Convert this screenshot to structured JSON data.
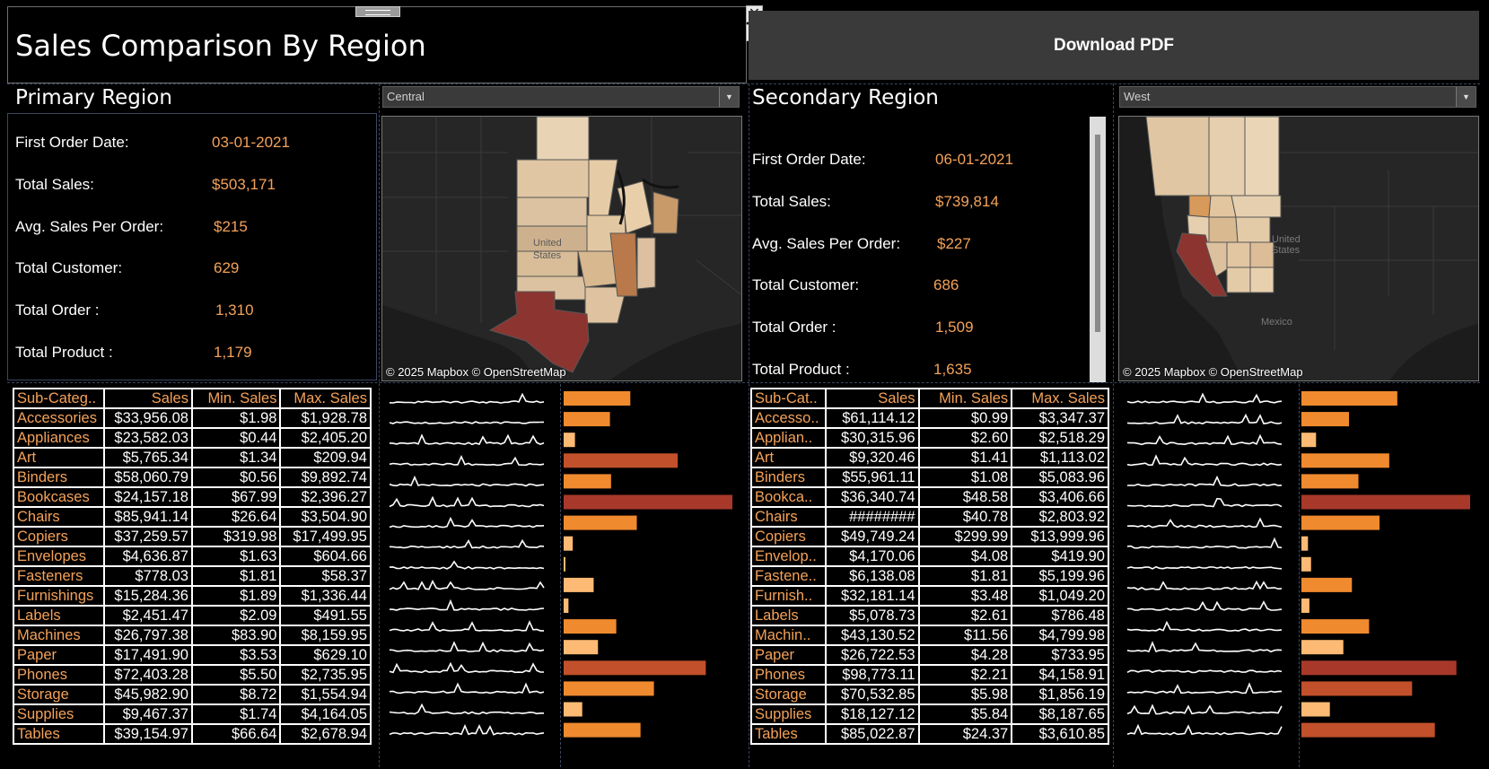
{
  "header": {
    "title": "Sales Comparison By Region",
    "download_label": "Download PDF",
    "close_glyph": "✕",
    "menu_glyph": "▼"
  },
  "primary": {
    "heading": "Primary Region",
    "selected_region": "Central",
    "kpis": [
      {
        "label": "First Order Date:",
        "value": "03-01-2021"
      },
      {
        "label": "Total Sales:",
        "value": "$503,171"
      },
      {
        "label": "Avg. Sales Per Order:",
        "value": "$215"
      },
      {
        "label": "Total  Customer:",
        "value": "629"
      },
      {
        "label": "Total Order :",
        "value": "1,310"
      },
      {
        "label": "Total Product :",
        "value": "1,179"
      }
    ],
    "map": {
      "credit": "© 2025 Mapbox © OpenStreetMap",
      "country_label": "United States",
      "country_label_l1": "United",
      "country_label_l2": "States"
    },
    "table": {
      "headers": [
        "Sub-Categ..",
        "Sales",
        "Min. Sales",
        "Max. Sales"
      ],
      "rows": [
        [
          "Accessories",
          "$33,956.08",
          "$1.98",
          "$1,928.78"
        ],
        [
          "Appliances",
          "$23,582.03",
          "$0.44",
          "$2,405.20"
        ],
        [
          "Art",
          "$5,765.34",
          "$1.34",
          "$209.94"
        ],
        [
          "Binders",
          "$58,060.79",
          "$0.56",
          "$9,892.74"
        ],
        [
          "Bookcases",
          "$24,157.18",
          "$67.99",
          "$2,396.27"
        ],
        [
          "Chairs",
          "$85,941.14",
          "$26.64",
          "$3,504.90"
        ],
        [
          "Copiers",
          "$37,259.57",
          "$319.98",
          "$17,499.95"
        ],
        [
          "Envelopes",
          "$4,636.87",
          "$1.63",
          "$604.66"
        ],
        [
          "Fasteners",
          "$778.03",
          "$1.81",
          "$58.37"
        ],
        [
          "Furnishings",
          "$15,284.36",
          "$1.89",
          "$1,336.44"
        ],
        [
          "Labels",
          "$2,451.47",
          "$2.09",
          "$491.55"
        ],
        [
          "Machines",
          "$26,797.38",
          "$83.90",
          "$8,159.95"
        ],
        [
          "Paper",
          "$17,491.90",
          "$3.53",
          "$629.10"
        ],
        [
          "Phones",
          "$72,403.28",
          "$5.50",
          "$2,735.95"
        ],
        [
          "Storage",
          "$45,982.90",
          "$8.72",
          "$1,554.94"
        ],
        [
          "Supplies",
          "$9,467.37",
          "$1.74",
          "$4,164.05"
        ],
        [
          "Tables",
          "$39,154.97",
          "$66.64",
          "$2,678.94"
        ]
      ]
    },
    "bar_values": [
      33956.08,
      23582.03,
      5765.34,
      58060.79,
      24157.18,
      85941.14,
      37259.57,
      4636.87,
      778.03,
      15284.36,
      2451.47,
      26797.38,
      17491.9,
      72403.28,
      45982.9,
      9467.37,
      39154.97
    ]
  },
  "secondary": {
    "heading": "Secondary Region",
    "selected_region": "West",
    "kpis": [
      {
        "label": "First Order Date:",
        "value": "06-01-2021"
      },
      {
        "label": "Total Sales:",
        "value": "$739,814"
      },
      {
        "label": "Avg. Sales Per Order:",
        "value": "$227"
      },
      {
        "label": "Total  Customer:",
        "value": "686"
      },
      {
        "label": "Total Order :",
        "value": "1,509"
      },
      {
        "label": "Total Product :",
        "value": "1,635"
      }
    ],
    "map": {
      "credit": "© 2025 Mapbox © OpenStreetMap",
      "country_label_l1": "United",
      "country_label_l2": "States",
      "mexico_label": "Mexico"
    },
    "table": {
      "headers": [
        "Sub-Cat..",
        "Sales",
        "Min. Sales",
        "Max. Sales"
      ],
      "rows": [
        [
          "Accesso..",
          "$61,114.12",
          "$0.99",
          "$3,347.37"
        ],
        [
          "Applian..",
          "$30,315.96",
          "$2.60",
          "$2,518.29"
        ],
        [
          "Art",
          "$9,320.46",
          "$1.41",
          "$1,113.02"
        ],
        [
          "Binders",
          "$55,961.11",
          "$1.08",
          "$5,083.96"
        ],
        [
          "Bookca..",
          "$36,340.74",
          "$48.58",
          "$3,406.66"
        ],
        [
          "Chairs",
          "########",
          "$40.78",
          "$2,803.92"
        ],
        [
          "Copiers",
          "$49,749.24",
          "$299.99",
          "$13,999.96"
        ],
        [
          "Envelop..",
          "$4,170.06",
          "$4.08",
          "$419.90"
        ],
        [
          "Fastene..",
          "$6,138.08",
          "$1.81",
          "$5,199.96"
        ],
        [
          "Furnish..",
          "$32,181.14",
          "$3.48",
          "$1,049.20"
        ],
        [
          "Labels",
          "$5,078.73",
          "$2.61",
          "$786.48"
        ],
        [
          "Machin..",
          "$43,130.52",
          "$11.56",
          "$4,799.98"
        ],
        [
          "Paper",
          "$26,722.53",
          "$4.28",
          "$733.95"
        ],
        [
          "Phones",
          "$98,773.11",
          "$2.21",
          "$4,158.91"
        ],
        [
          "Storage",
          "$70,532.85",
          "$5.98",
          "$1,856.19"
        ],
        [
          "Supplies",
          "$18,127.12",
          "$5.84",
          "$8,187.65"
        ],
        [
          "Tables",
          "$85,022.87",
          "$24.37",
          "$3,610.85"
        ]
      ]
    },
    "bar_values": [
      61114.12,
      30315.96,
      9320.46,
      55961.11,
      36340.74,
      107532.16,
      49749.24,
      4170.06,
      6138.08,
      32181.14,
      5078.73,
      43130.52,
      26722.53,
      98773.11,
      70532.85,
      18127.12,
      85022.87
    ]
  },
  "colors": {
    "accent_orange": "#f4a259",
    "bar_low": "#fdba74",
    "bar_mid": "#f08a2e",
    "bar_high": "#c2502a",
    "bar_max": "#a8392a",
    "map_highlight": "#8c3530",
    "background": "#000000",
    "button_bg": "#3a3a3a"
  }
}
